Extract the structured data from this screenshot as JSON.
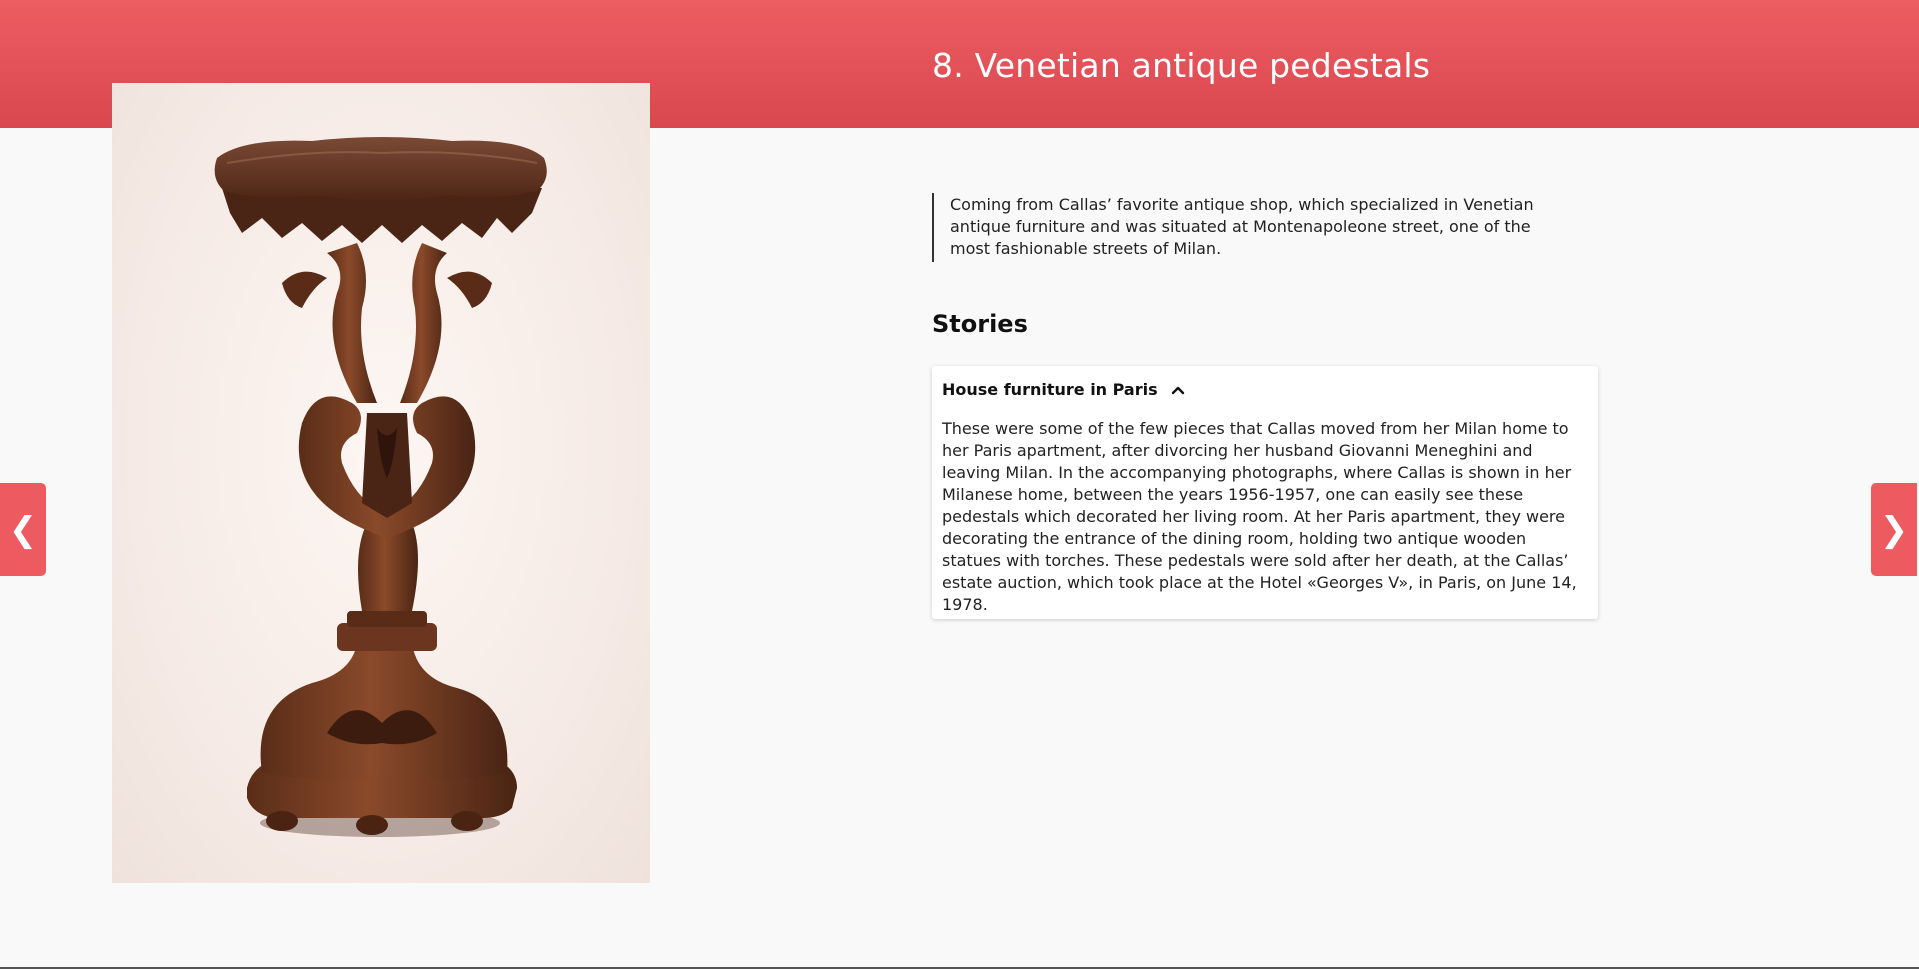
{
  "header": {
    "title": "8. Venetian antique pedestals",
    "accent_color": "#e3525a"
  },
  "artwork": {
    "alt": "Carved wooden Venetian antique pedestal"
  },
  "description": "Coming from Callas’ favorite antique shop, which specialized in Venetian antique furniture and was situated at Montenapoleone street, one of the most fashionable streets of Milan.",
  "stories": {
    "heading": "Stories",
    "items": [
      {
        "title": "House furniture in Paris",
        "expanded": true,
        "body": "These were some of the few pieces that Callas moved from her Milan home to her Paris apartment, after divorcing her husband Giovanni Meneghini and leaving Milan. In the accompanying photographs, where Callas is shown in her Milanese home, between the years 1956-1957, one can easily see these pedestals which decorated her living room. At her Paris apartment, they were decorating the entrance of the dining room, holding two antique wooden statues with torches. These pedestals were sold after her death, at the Callas’ estate auction, which took place at the Hotel «Georges V», in Paris, on June 14, 1978."
      }
    ]
  },
  "navigation": {
    "prev_icon": "chevron-left-icon",
    "next_icon": "chevron-right-icon",
    "prev_glyph": "❮",
    "next_glyph": "❯"
  }
}
